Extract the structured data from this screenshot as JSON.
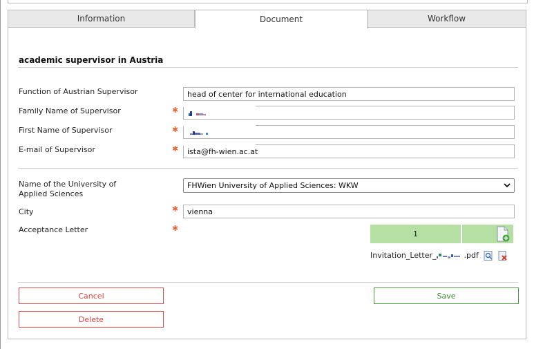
{
  "tabs": [
    {
      "label": "Information",
      "active": false
    },
    {
      "label": "Document",
      "active": true
    },
    {
      "label": "Workflow",
      "active": false
    }
  ],
  "section": {
    "title": "academic supervisor in Austria"
  },
  "fields": {
    "function": {
      "label": "Function of Austrian Supervisor",
      "value": "head of center for international education",
      "required": false
    },
    "family_name": {
      "label": "Family Name of Supervisor",
      "value": "",
      "required": true
    },
    "first_name": {
      "label": "First Name of Supervisor",
      "value": "",
      "required": true
    },
    "email": {
      "label": "E-mail of Supervisor",
      "value": "ista@fh-wien.ac.at",
      "required": true
    },
    "university": {
      "label": "Name of the University of Applied Sciences",
      "value": "FHWien University of Applied Sciences: WKW",
      "required": false
    },
    "city": {
      "label": "City",
      "value": "vienna",
      "required": true
    },
    "acceptance": {
      "label": "Acceptance Letter",
      "required": true
    }
  },
  "upload": {
    "count": "1",
    "file_prefix": "Invitation_Letter_",
    "file_suffix": ".pdf"
  },
  "buttons": {
    "cancel": "Cancel",
    "delete": "Delete",
    "save": "Save"
  },
  "colors": {
    "required_star": "#e06a3b",
    "upload_green": "#b6dfa3",
    "danger": "#d9443f",
    "success": "#3e8a32"
  }
}
